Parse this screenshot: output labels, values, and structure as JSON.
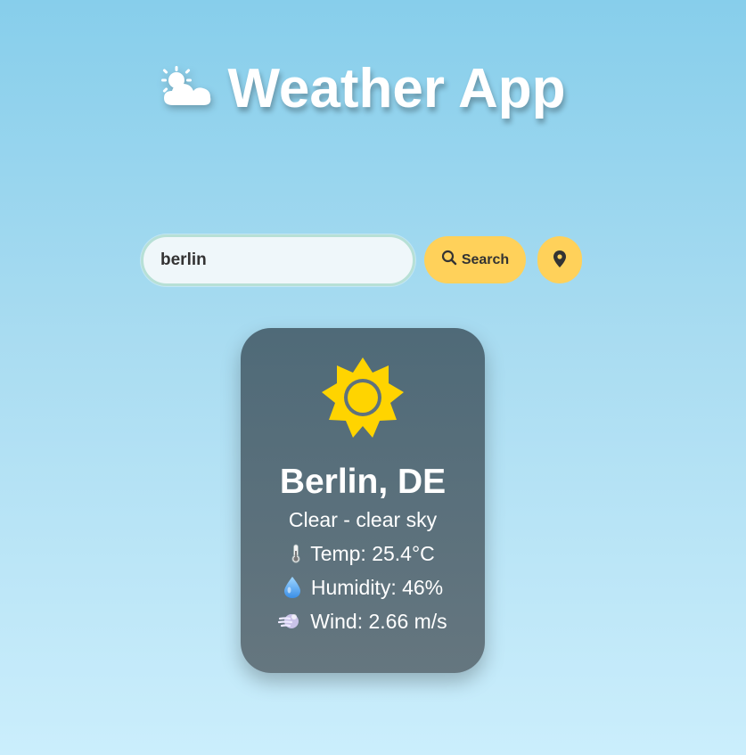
{
  "header": {
    "title": "Weather App",
    "icon": "sun-behind-cloud-icon"
  },
  "search": {
    "value": "berlin",
    "button_label": "Search",
    "button_icon": "search-icon",
    "location_icon": "map-pin-icon"
  },
  "weather": {
    "icon": "sun-icon",
    "city": "Berlin, DE",
    "description": "Clear - clear sky",
    "temp": "Temp: 25.4°C",
    "temp_icon": "thermometer-icon",
    "humidity": "Humidity: 46%",
    "humidity_icon": "droplet-icon",
    "wind": "Wind: 2.66 m/s",
    "wind_icon": "wind-icon"
  },
  "colors": {
    "background_top": "#87ceeb",
    "background_bottom": "#cbeefc",
    "accent": "#ffd15a",
    "card": "#5a6f7b",
    "sun": "#ffd400"
  }
}
